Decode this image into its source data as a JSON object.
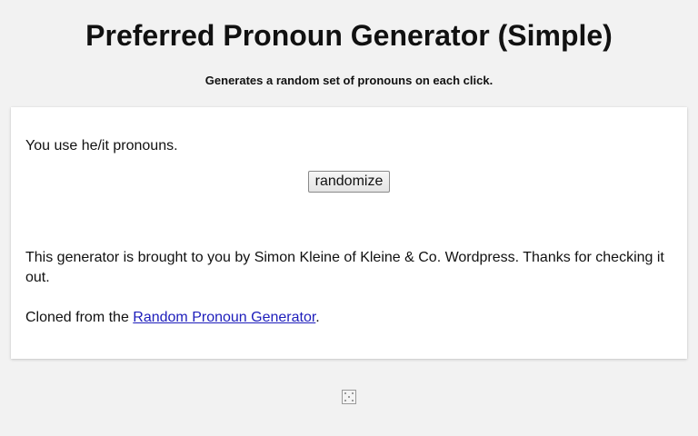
{
  "header": {
    "title": "Preferred Pronoun Generator (Simple)",
    "subtitle": "Generates a random set of pronouns on each click."
  },
  "main": {
    "result_text": "You use he/it pronouns.",
    "randomize_label": "randomize",
    "credits_text": "This generator is brought to you by Simon Kleine of Kleine & Co. Wordpress. Thanks for checking it out.",
    "cloned_prefix": "Cloned from the ",
    "cloned_link_label": "Random Pronoun Generator",
    "cloned_suffix": "."
  },
  "footer": {
    "image_icon": "broken-image-icon"
  },
  "colors": {
    "background": "#f2f2f2",
    "card": "#ffffff",
    "link": "#1d1dbb"
  }
}
